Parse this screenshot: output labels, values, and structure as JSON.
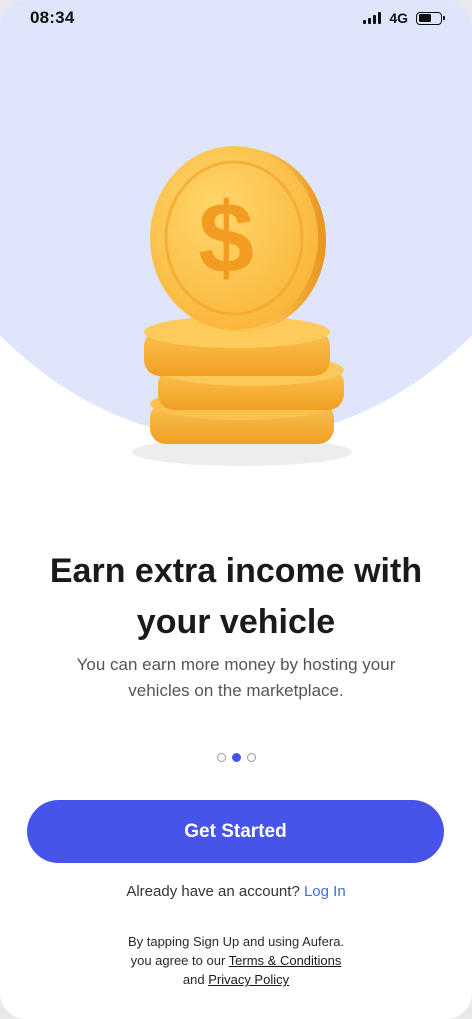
{
  "status_bar": {
    "time": "08:34",
    "network": "4G",
    "icons": [
      "cellular-signal-icon",
      "battery-icon"
    ],
    "battery_level": 0.6
  },
  "hero": {
    "illustration": "gold-coin-stack",
    "coin_symbol": "$"
  },
  "headline": {
    "line1": "Earn extra income with",
    "line2": "your vehicle"
  },
  "subtitle": {
    "line1": "You can earn more money by hosting your",
    "line2": "vehicles on the marketplace."
  },
  "pagination": {
    "total": 3,
    "active_index": 1
  },
  "cta": {
    "label": "Get Started"
  },
  "login": {
    "prompt": "Already have an account?",
    "link_label": "Log In"
  },
  "legal": {
    "line1": "By tapping Sign Up and using Aufera.",
    "line2_prefix": "you agree to our",
    "terms_link": "Terms & Conditions",
    "line3_prefix": "and",
    "privacy_link": "Privacy Policy"
  },
  "colors": {
    "primary": "#4654ea",
    "hero_background": "#dfe6fb",
    "link": "#3b6ee6",
    "coin_gold": "#fbbf45",
    "coin_shadow": "#f0a020"
  }
}
